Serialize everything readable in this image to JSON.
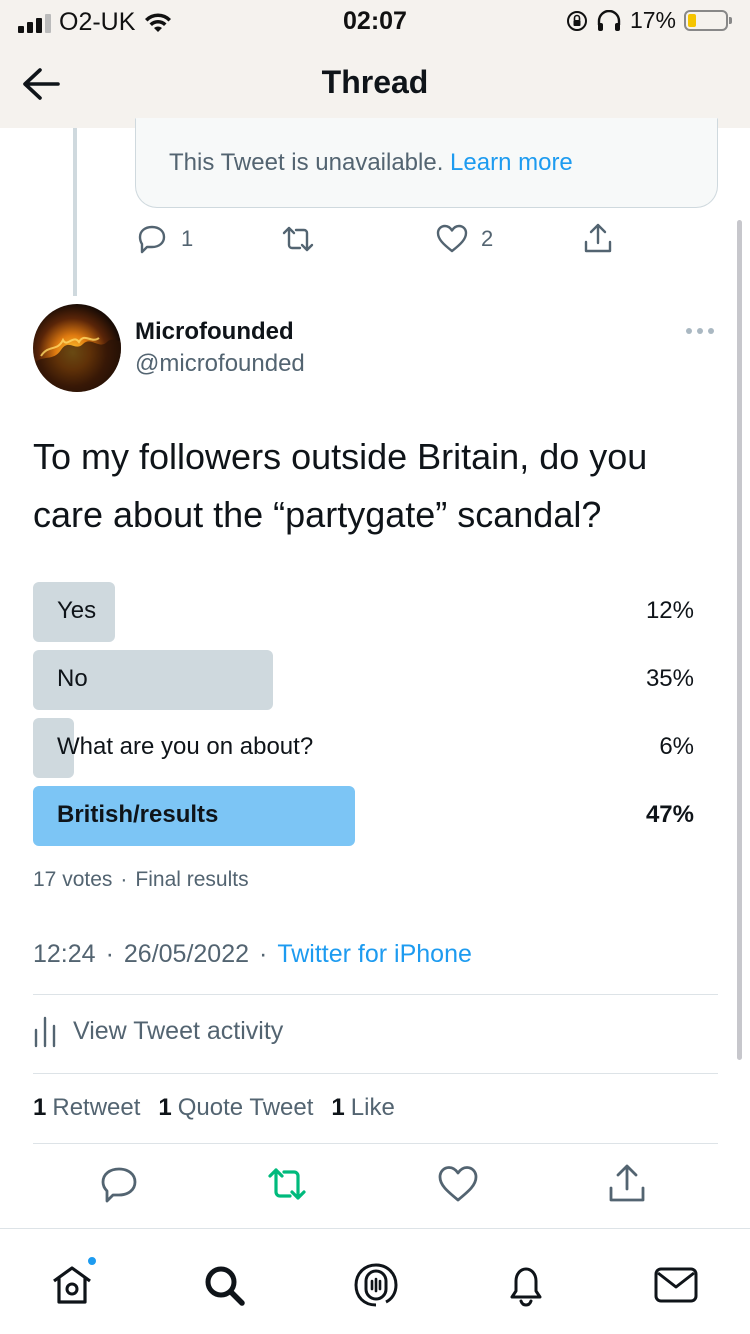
{
  "status_bar": {
    "carrier": "O2-UK",
    "time": "02:07",
    "battery_percent": "17%",
    "battery_level": 0.17,
    "battery_color": "#f5c400"
  },
  "header": {
    "title": "Thread",
    "back_icon": "arrow-left-icon"
  },
  "unavailable_tweet": {
    "message": "This Tweet is unavailable.",
    "link_text": "Learn more"
  },
  "parent_actions": {
    "reply_count": "1",
    "retweet_count": "",
    "like_count": "2"
  },
  "tweet": {
    "author_name": "Microfounded",
    "author_handle": "@microfounded",
    "text": "To my followers outside Britain, do you care about the “partygate” scandal?",
    "poll": {
      "options": [
        {
          "label": "Yes",
          "percent_text": "12%",
          "percent": 12,
          "winner": false
        },
        {
          "label": "No",
          "percent_text": "35%",
          "percent": 35,
          "winner": false
        },
        {
          "label": "What are you on about?",
          "percent_text": "6%",
          "percent": 6,
          "winner": false
        },
        {
          "label": "British/results",
          "percent_text": "47%",
          "percent": 47,
          "winner": true
        }
      ],
      "votes": "17 votes",
      "status": "Final results"
    },
    "time": "12:24",
    "date": "26/05/2022",
    "source": "Twitter for iPhone",
    "activity_label": "View Tweet activity",
    "stats": {
      "retweets_count": "1",
      "retweets_label": "Retweet",
      "quotes_count": "1",
      "quotes_label": "Quote Tweet",
      "likes_count": "1",
      "likes_label": "Like"
    }
  },
  "tabbar": {
    "items": [
      "home-icon",
      "search-icon",
      "spaces-icon",
      "notifications-icon",
      "messages-icon"
    ],
    "active_color": "#0f1419"
  },
  "colors": {
    "accent": "#1d9bf0",
    "retweet_green": "#00ba7c",
    "poll_winner": "#7cc5f5",
    "poll_bar": "#cfd9de"
  }
}
